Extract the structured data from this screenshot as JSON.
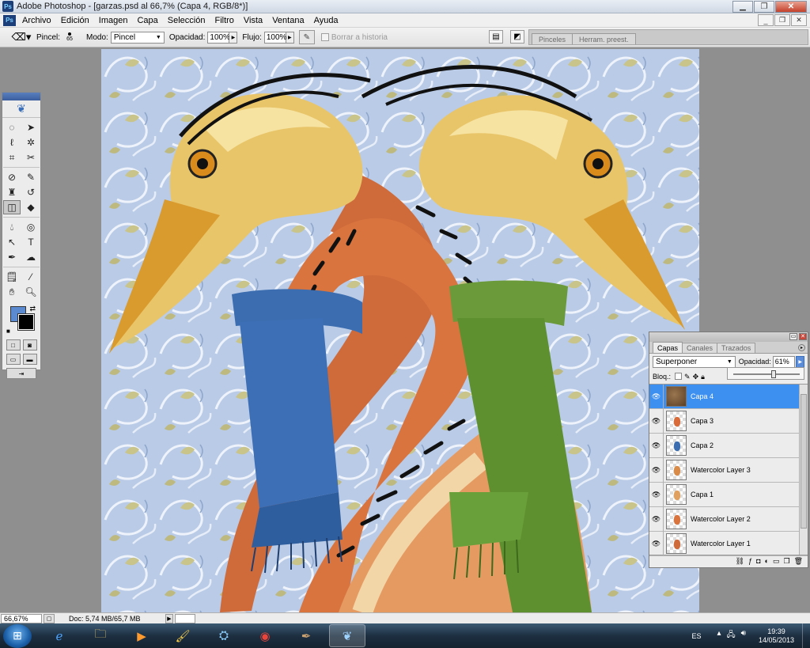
{
  "window": {
    "app_icon": "Ps",
    "title": "Adobe Photoshop - [garzas.psd al 66,7% (Capa 4, RGB/8*)]",
    "controls": [
      "minimize-icon",
      "maximize-icon",
      "close-icon"
    ]
  },
  "menu": {
    "items": [
      "Archivo",
      "Edición",
      "Imagen",
      "Capa",
      "Selección",
      "Filtro",
      "Vista",
      "Ventana",
      "Ayuda"
    ]
  },
  "options": {
    "brush_label": "Pincel:",
    "brush_size": "65",
    "mode_label": "Modo:",
    "mode_value": "Pincel",
    "opacity_label": "Opacidad:",
    "opacity_value": "100%",
    "flow_label": "Flujo:",
    "flow_value": "100%",
    "history_label": "Borrar a historia",
    "palette_well_tabs": [
      "Pinceles",
      "Herram. preest."
    ]
  },
  "toolbox": {
    "foreground_color": "#5b8ad0",
    "background_color": "#000000",
    "tools": [
      "marquee-icon",
      "move-icon",
      "lasso-icon",
      "magic-wand-icon",
      "crop-icon",
      "slice-icon",
      "healing-brush-icon",
      "brush-icon",
      "clone-stamp-icon",
      "history-brush-icon",
      "eraser-icon",
      "paint-bucket-icon",
      "blur-icon",
      "dodge-icon",
      "path-selection-icon",
      "type-icon",
      "pen-icon",
      "custom-shape-icon",
      "notes-icon",
      "eyedropper-icon",
      "hand-icon",
      "zoom-icon"
    ],
    "selected_tool": "eraser-icon"
  },
  "layers_panel": {
    "tabs": [
      "Capas",
      "Canales",
      "Trazados"
    ],
    "active_tab": "Capas",
    "blend_mode": "Superponer",
    "opacity_label": "Opacidad:",
    "opacity_value": "61%",
    "opacity_fraction": 0.61,
    "lock_label": "Bloq.:",
    "layers": [
      {
        "name": "Capa 4",
        "selected": true,
        "visible": true
      },
      {
        "name": "Capa 3",
        "selected": false,
        "visible": true
      },
      {
        "name": "Capa 2",
        "selected": false,
        "visible": true
      },
      {
        "name": "Watercolor Layer 3",
        "selected": false,
        "visible": true
      },
      {
        "name": "Capa 1",
        "selected": false,
        "visible": true
      },
      {
        "name": "Watercolor Layer 2",
        "selected": false,
        "visible": true
      },
      {
        "name": "Watercolor Layer 1",
        "selected": false,
        "visible": true
      }
    ]
  },
  "status": {
    "zoom": "66,67%",
    "doc_info": "Doc: 5,74 MB/65,7 MB"
  },
  "taskbar": {
    "apps": [
      "internet-explorer-icon",
      "folder-icon",
      "media-player-icon",
      "painter-icon",
      "network-icon",
      "chrome-icon",
      "pen-tablet-icon",
      "photoshop-icon"
    ],
    "active_app": "photoshop-icon",
    "language": "ES",
    "time": "19:39",
    "date": "14/05/2013"
  }
}
